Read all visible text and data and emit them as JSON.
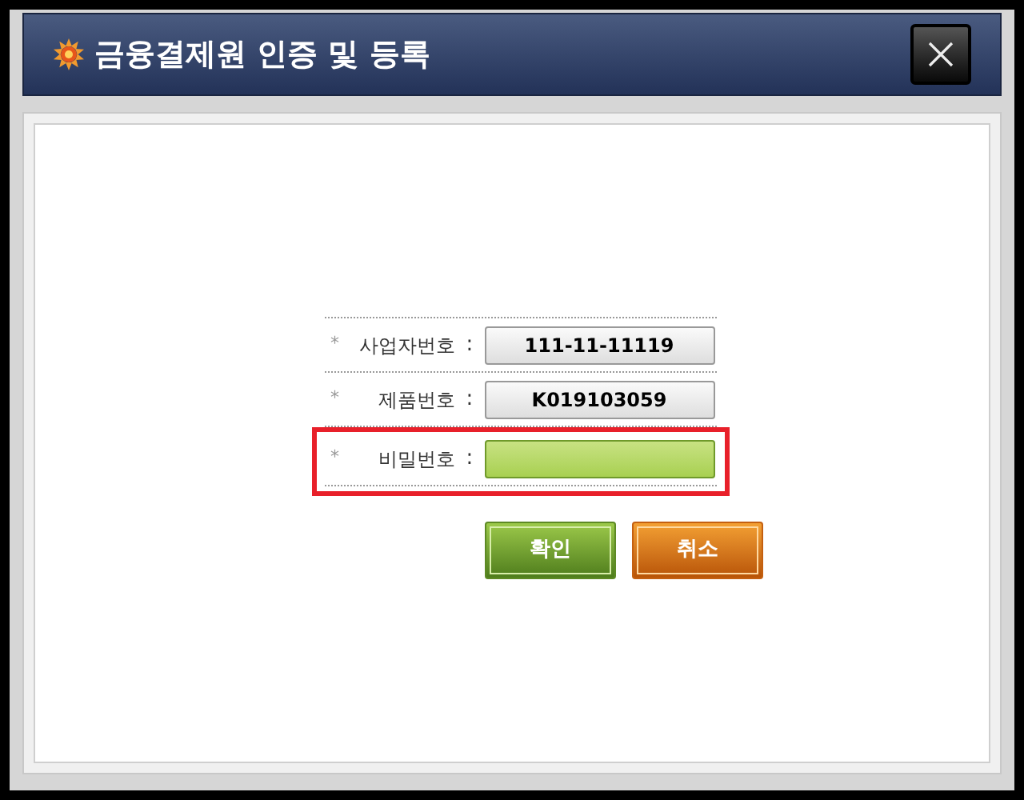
{
  "window": {
    "title": "금융결제원 인증 및 등록"
  },
  "form": {
    "rows": [
      {
        "marker": "*",
        "label": "사업자번호",
        "separator": ":",
        "value": "111-11-11119",
        "editable": false,
        "highlighted": false
      },
      {
        "marker": "*",
        "label": "제품번호",
        "separator": ":",
        "value": "K019103059",
        "editable": false,
        "highlighted": false
      },
      {
        "marker": "*",
        "label": "비밀번호",
        "separator": ":",
        "editable": true,
        "highlighted": true
      }
    ]
  },
  "buttons": [
    {
      "label": "확인",
      "kind": "confirm"
    },
    {
      "label": "취소",
      "kind": "cancel"
    }
  ]
}
